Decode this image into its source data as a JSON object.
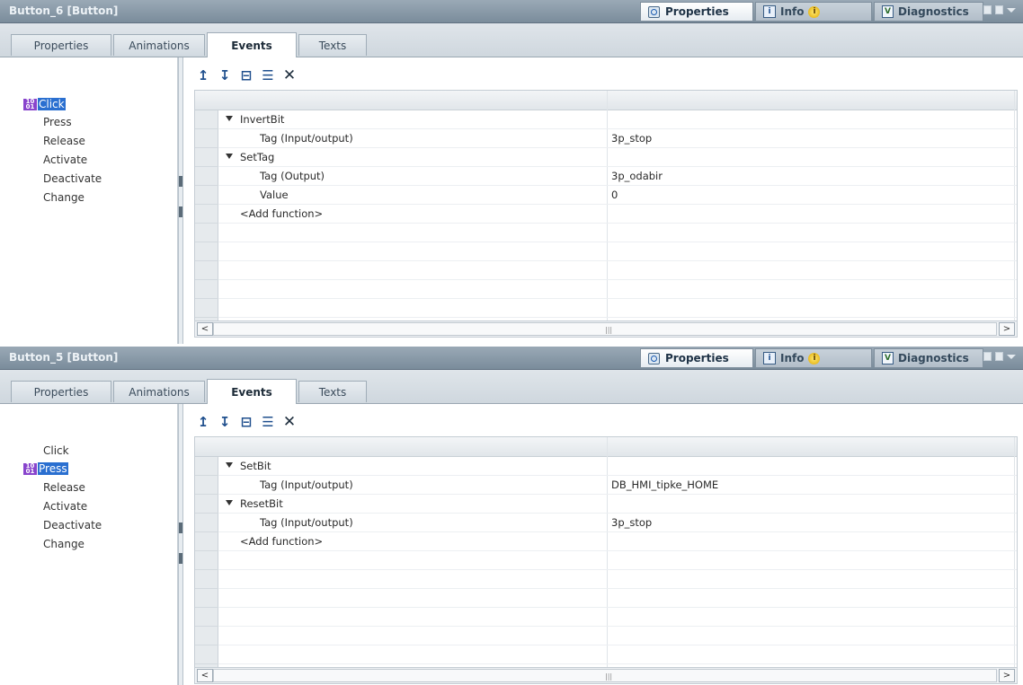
{
  "colors": {
    "titlebar": "#8596a5",
    "selection": "#2a6fd0",
    "accent": "#1f4f8d"
  },
  "inspector_tabs": [
    {
      "label": "Properties",
      "icon": "properties-icon"
    },
    {
      "label": "Info",
      "icon": "info-icon"
    },
    {
      "label": "Diagnostics",
      "icon": "diagnostics-icon"
    }
  ],
  "subtabs": [
    "Properties",
    "Animations",
    "Events",
    "Texts"
  ],
  "events": [
    "Click",
    "Press",
    "Release",
    "Activate",
    "Deactivate",
    "Change"
  ],
  "panels": [
    {
      "title": "Button_6 [Button]",
      "selected_event": "Click",
      "rows": [
        {
          "type": "function",
          "name": "InvertBit"
        },
        {
          "type": "param",
          "name": "Tag (Input/output)",
          "value": "3p_stop"
        },
        {
          "type": "function",
          "name": "SetTag"
        },
        {
          "type": "param",
          "name": "Tag (Output)",
          "value": "3p_odabir"
        },
        {
          "type": "param",
          "name": "Value",
          "value": "0"
        },
        {
          "type": "add",
          "name": "<Add function>"
        }
      ]
    },
    {
      "title": "Button_5 [Button]",
      "selected_event": "Press",
      "rows": [
        {
          "type": "function",
          "name": "SetBit"
        },
        {
          "type": "param",
          "name": "Tag (Input/output)",
          "value": "DB_HMI_tipke_HOME"
        },
        {
          "type": "function",
          "name": "ResetBit"
        },
        {
          "type": "param",
          "name": "Tag (Input/output)",
          "value": "3p_stop"
        },
        {
          "type": "add",
          "name": "<Add function>"
        }
      ]
    }
  ]
}
